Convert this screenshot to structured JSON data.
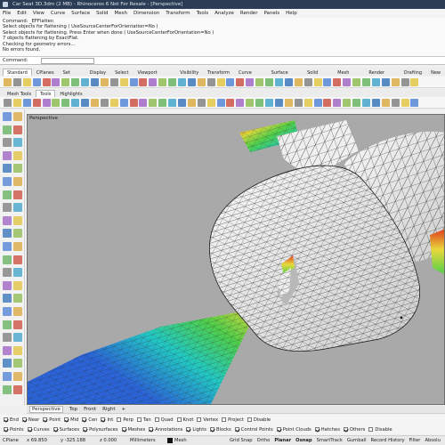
{
  "titlebar": {
    "title": "Car Seat 3D.3dm (2 MB) - Rhinoceros 6 Not For Resale - [Perspective]"
  },
  "menubar": {
    "items": [
      "File",
      "Edit",
      "View",
      "Curve",
      "Surface",
      "Solid",
      "Mesh",
      "Dimension",
      "Transform",
      "Tools",
      "Analyze",
      "Render",
      "Panels",
      "Help"
    ]
  },
  "command_history": {
    "lines": [
      "Command: _EFFlatten",
      "Select objects for flattening ( UseSourceCenterForOrientation=No )",
      "Select objects for flattening. Press Enter when done ( UseSourceCenterForOrientation=No )",
      "7 objects flattening by ExactFlat.",
      "Checking for geometry errors...",
      "No errors found."
    ],
    "prompt": "Command:"
  },
  "toolbar_tabs": [
    "Standard",
    "CPlanes",
    "Set View",
    "Display",
    "Select",
    "Viewport Layout",
    "Visibility",
    "Transform",
    "Curve Tools",
    "Surface Tools",
    "Solid Tools",
    "Mesh Tools",
    "Render Tools",
    "Drafting",
    "New"
  ],
  "sub_tabs": [
    "Mesh Tools",
    "Tools",
    "Highlights"
  ],
  "viewport": {
    "label": "Perspective"
  },
  "viewport_tabs": [
    "Perspective",
    "Top",
    "Front",
    "Right"
  ],
  "viewport_add": "+",
  "osnaps": [
    {
      "label": "End",
      "checked": true
    },
    {
      "label": "Near",
      "checked": true
    },
    {
      "label": "Point",
      "checked": true
    },
    {
      "label": "Mid",
      "checked": true
    },
    {
      "label": "Cen",
      "checked": true
    },
    {
      "label": "Int",
      "checked": true
    },
    {
      "label": "Perp",
      "checked": false
    },
    {
      "label": "Tan",
      "checked": false
    },
    {
      "label": "Quad",
      "checked": false
    },
    {
      "label": "Knot",
      "checked": false
    },
    {
      "label": "Vertex",
      "checked": false
    },
    {
      "label": "Project",
      "checked": false
    },
    {
      "label": "Disable",
      "checked": false
    }
  ],
  "selection_filters": [
    {
      "label": "Points",
      "checked": true
    },
    {
      "label": "Curves",
      "checked": true
    },
    {
      "label": "Surfaces",
      "checked": true
    },
    {
      "label": "Polysurfaces",
      "checked": true
    },
    {
      "label": "Meshes",
      "checked": true
    },
    {
      "label": "Annotations",
      "checked": true
    },
    {
      "label": "Lights",
      "checked": true
    },
    {
      "label": "Blocks",
      "checked": true
    },
    {
      "label": "Control Points",
      "checked": true
    },
    {
      "label": "Point Clouds",
      "checked": true
    },
    {
      "label": "Hatches",
      "checked": true
    },
    {
      "label": "Others",
      "checked": true
    },
    {
      "label": "Disable",
      "checked": false
    }
  ],
  "status": {
    "cplane": "CPlane",
    "x": "x 69.850",
    "y": "y -325.188",
    "z": "z 0.000",
    "units": "Millimeters",
    "layer": "Mesh",
    "modes": [
      "Grid Snap",
      "Ortho",
      "Planar",
      "Osnap",
      "SmartTrack",
      "Gumball",
      "Record History",
      "Filter",
      "Absolu"
    ]
  },
  "colors": {
    "titlebar": "#2b3d55",
    "viewport_bg": "#a9a9a9",
    "mesh_fill": "#f3f3f3",
    "analysis_blue": "#2b64d8",
    "analysis_cyan": "#22c9c4",
    "analysis_green": "#4fcf4a",
    "analysis_yellow": "#e8d83a",
    "analysis_red": "#e03a1e"
  }
}
